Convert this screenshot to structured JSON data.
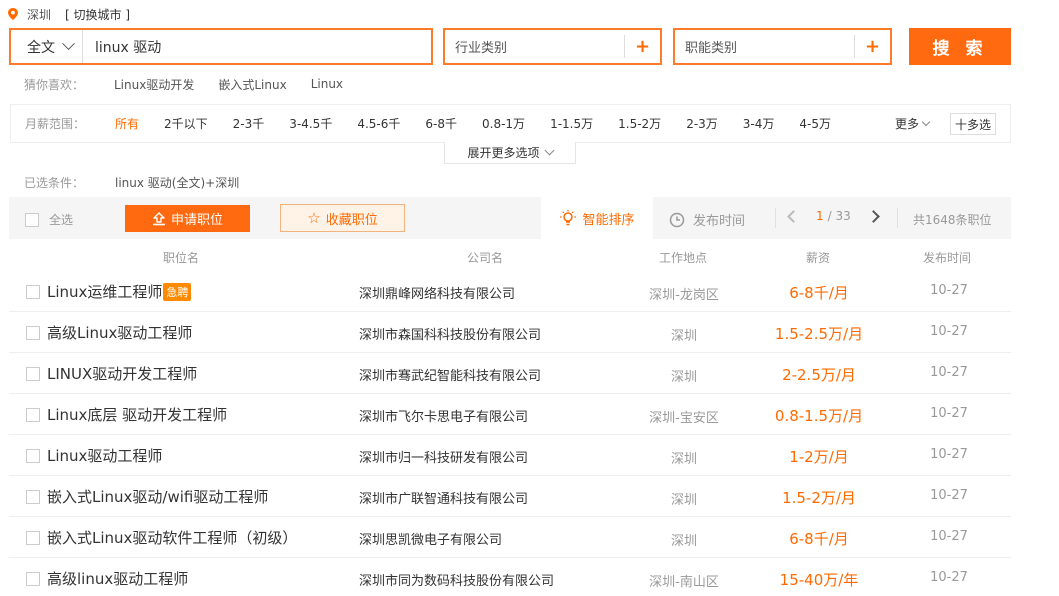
{
  "location": {
    "city": "深圳",
    "switch_label": "[ 切换城市 ]"
  },
  "search": {
    "scope": "全文",
    "keyword": "linux 驱动",
    "industry_label": "行业类别",
    "function_label": "职能类别",
    "plus": "+",
    "button": "搜 索"
  },
  "guess": {
    "label": "猜你喜欢：",
    "tags": [
      "Linux驱动开发",
      "嵌入式Linux",
      "Linux"
    ]
  },
  "salary_filter": {
    "label": "月薪范围：",
    "options": [
      "所有",
      "2千以下",
      "2-3千",
      "3-4.5千",
      "4.5-6千",
      "6-8千",
      "0.8-1万",
      "1-1.5万",
      "1.5-2万",
      "2-3万",
      "3-4万",
      "4-5万"
    ],
    "selected": "所有",
    "more": "更多",
    "multi": "十多选",
    "expand": "展开更多选项"
  },
  "selected_conditions": {
    "label": "已选条件：",
    "value": "linux 驱动(全文)+深圳"
  },
  "toolbar": {
    "select_all": "全选",
    "apply": "申请职位",
    "favorite": "收藏职位",
    "sort_smart": "智能排序",
    "sort_time": "发布时间",
    "page_current": "1",
    "page_total": "/ 33",
    "total": "共1648条职位"
  },
  "columns": {
    "title": "职位名",
    "company": "公司名",
    "location": "工作地点",
    "salary": "薪资",
    "date": "发布时间"
  },
  "jobs": [
    {
      "title": "Linux运维工程师",
      "urgent": "急聘",
      "company": "深圳鼎峰网络科技有限公司",
      "location": "深圳-龙岗区",
      "salary": "6-8千/月",
      "date": "10-27"
    },
    {
      "title": "高级Linux驱动工程师",
      "urgent": "",
      "company": "深圳市森国科科技股份有限公司",
      "location": "深圳",
      "salary": "1.5-2.5万/月",
      "date": "10-27"
    },
    {
      "title": "LINUX驱动开发工程师",
      "urgent": "",
      "company": "深圳市骞武纪智能科技有限公司",
      "location": "深圳",
      "salary": "2-2.5万/月",
      "date": "10-27"
    },
    {
      "title": "Linux底层 驱动开发工程师",
      "urgent": "",
      "company": "深圳市飞尔卡思电子有限公司",
      "location": "深圳-宝安区",
      "salary": "0.8-1.5万/月",
      "date": "10-27"
    },
    {
      "title": "Linux驱动工程师",
      "urgent": "",
      "company": "深圳市归一科技研发有限公司",
      "location": "深圳",
      "salary": "1-2万/月",
      "date": "10-27"
    },
    {
      "title": "嵌入式Linux驱动/wifi驱动工程师",
      "urgent": "",
      "company": "深圳市广联智通科技有限公司",
      "location": "深圳",
      "salary": "1.5-2万/月",
      "date": "10-27"
    },
    {
      "title": "嵌入式Linux驱动软件工程师（初级）",
      "urgent": "",
      "company": "深圳思凯微电子有限公司",
      "location": "深圳",
      "salary": "6-8千/月",
      "date": "10-27"
    },
    {
      "title": "高级linux驱动工程师",
      "urgent": "",
      "company": "深圳市同为数码科技股份有限公司",
      "location": "深圳-南山区",
      "salary": "15-40万/年",
      "date": "10-27"
    }
  ]
}
